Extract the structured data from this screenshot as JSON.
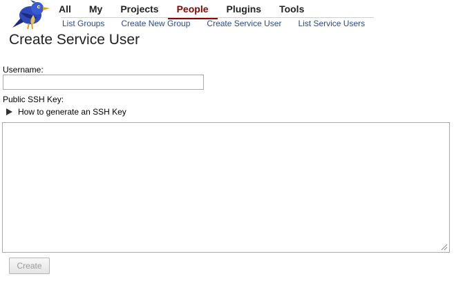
{
  "topnav": {
    "tabs": [
      {
        "label": "All"
      },
      {
        "label": "My"
      },
      {
        "label": "Projects"
      },
      {
        "label": "People",
        "active": true
      },
      {
        "label": "Plugins"
      },
      {
        "label": "Tools"
      }
    ]
  },
  "subnav": {
    "links": [
      {
        "label": "List Groups"
      },
      {
        "label": "Create New Group"
      },
      {
        "label": "Create Service User"
      },
      {
        "label": "List Service Users"
      }
    ]
  },
  "page": {
    "title": "Create Service User"
  },
  "form": {
    "username_label": "Username:",
    "username_value": "",
    "sshkey_label": "Public SSH Key:",
    "disclosure_label": "How to generate an SSH Key",
    "sshkey_value": "",
    "create_label": "Create"
  },
  "colors": {
    "active_tab": "#8b0000",
    "link": "#2a4a8a"
  },
  "icons": {
    "logo": "gerrit-bird-logo",
    "disclosure": "triangle-right-icon",
    "grip": "resize-grip-icon"
  }
}
